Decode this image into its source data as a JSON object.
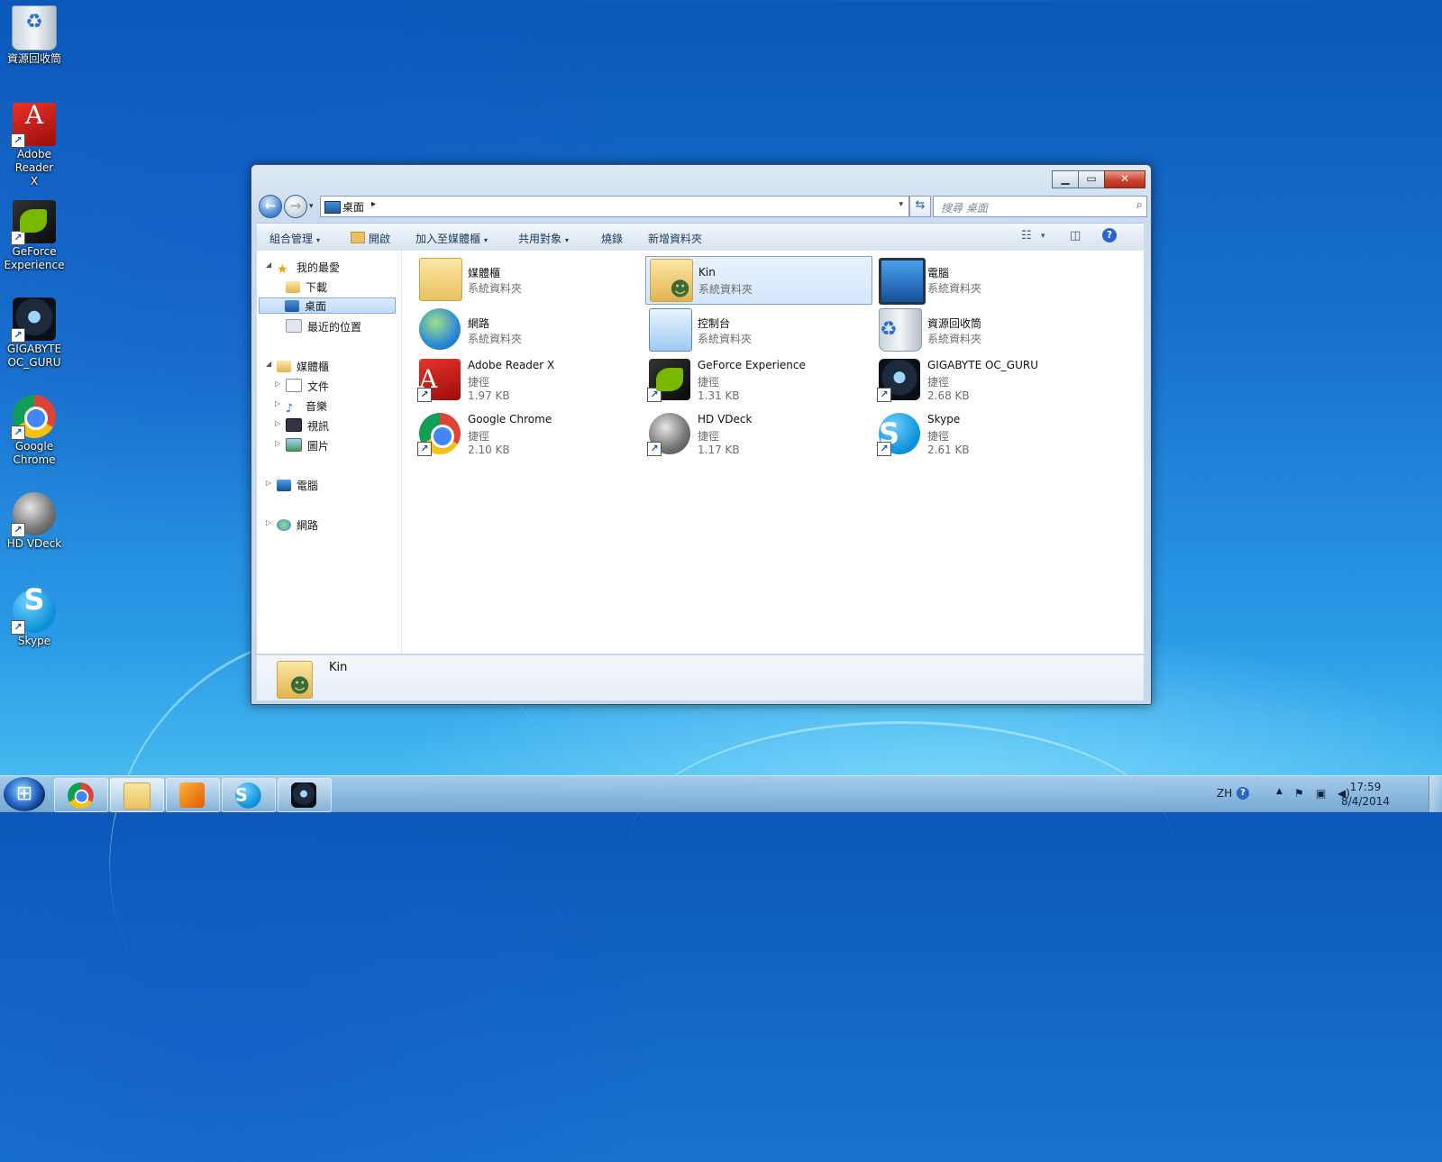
{
  "desktop": {
    "icons": [
      {
        "label": "資源回收筒",
        "icon": "recycle-bin-icon",
        "shortcut": false
      },
      {
        "label": "Adobe Reader X",
        "icon": "adobe-reader-icon",
        "shortcut": true
      },
      {
        "label": "GeForce Experience",
        "icon": "geforce-icon",
        "shortcut": true
      },
      {
        "label": "GIGABYTE OC_GURU",
        "icon": "gigabyte-icon",
        "shortcut": true
      },
      {
        "label": "Google Chrome",
        "icon": "chrome-icon",
        "shortcut": true
      },
      {
        "label": "HD VDeck",
        "icon": "vdeck-icon",
        "shortcut": true
      },
      {
        "label": "Skype",
        "icon": "skype-icon",
        "shortcut": true
      }
    ]
  },
  "explorer": {
    "window_buttons": {
      "minimize": "▁",
      "maximize": "▭",
      "close": "✕"
    },
    "nav": {
      "back": "←",
      "forward": "→",
      "dropdown": "▾"
    },
    "address": {
      "location": "桌面",
      "separator": "▸",
      "dropdown": "▾"
    },
    "refresh": "⇆",
    "search": {
      "placeholder": "搜尋 桌面",
      "icon": "⌕"
    },
    "toolbar": {
      "organize": "組合管理",
      "open": "開啟",
      "add_to_library": "加入至媒體櫃",
      "share_with": "共用對象",
      "burn": "燒錄",
      "new_folder": "新增資料夾",
      "dropdown_arrow": "▾",
      "view_icon": "☷",
      "preview_icon": "◫",
      "help": "?"
    },
    "nav_pane": {
      "favorites": {
        "label": "我的最愛",
        "items": [
          "下載",
          "桌面",
          "最近的位置"
        ]
      },
      "libraries": {
        "label": "媒體櫃",
        "items": [
          "文件",
          "音樂",
          "視訊",
          "圖片"
        ]
      },
      "computer": "電腦",
      "network": "網路",
      "expanded": "◢",
      "collapsed": "▷"
    },
    "files": [
      {
        "name": "媒體櫃",
        "type": "系統資料夾",
        "size": "",
        "icon": "library-icon"
      },
      {
        "name": "Kin",
        "type": "系統資料夾",
        "size": "",
        "icon": "user-folder-icon"
      },
      {
        "name": "電腦",
        "type": "系統資料夾",
        "size": "",
        "icon": "computer-icon"
      },
      {
        "name": "網路",
        "type": "系統資料夾",
        "size": "",
        "icon": "network-icon"
      },
      {
        "name": "控制台",
        "type": "系統資料夾",
        "size": "",
        "icon": "control-panel-icon"
      },
      {
        "name": "資源回收筒",
        "type": "系統資料夾",
        "size": "",
        "icon": "recycle-bin-icon"
      },
      {
        "name": "Adobe Reader X",
        "type": "捷徑",
        "size": "1.97 KB",
        "icon": "adobe-reader-icon"
      },
      {
        "name": "GeForce Experience",
        "type": "捷徑",
        "size": "1.31 KB",
        "icon": "geforce-icon"
      },
      {
        "name": "GIGABYTE OC_GURU",
        "type": "捷徑",
        "size": "2.68 KB",
        "icon": "gigabyte-icon"
      },
      {
        "name": "Google Chrome",
        "type": "捷徑",
        "size": "2.10 KB",
        "icon": "chrome-icon"
      },
      {
        "name": "HD VDeck",
        "type": "捷徑",
        "size": "1.17 KB",
        "icon": "vdeck-icon"
      },
      {
        "name": "Skype",
        "type": "捷徑",
        "size": "2.61 KB",
        "icon": "skype-icon"
      }
    ],
    "selected_file": "Kin",
    "details_pane": {
      "name": "Kin"
    }
  },
  "taskbar": {
    "pinned": [
      "chrome-icon",
      "explorer-icon",
      "media-player-icon",
      "skype-icon",
      "gigabyte-icon"
    ],
    "tray": {
      "lang": "ZH",
      "help": "?",
      "up_arrow": "▲",
      "flag": "⚑",
      "network": "▣",
      "volume": "◀)"
    },
    "clock": {
      "time": "17:59",
      "date": "8/4/2014"
    }
  }
}
